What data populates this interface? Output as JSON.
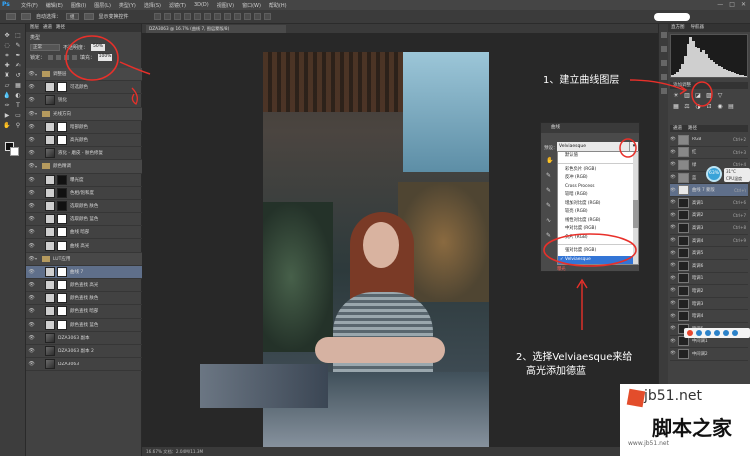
{
  "menubar": {
    "logo": "Ps",
    "items": [
      "文件(F)",
      "编辑(E)",
      "图像(I)",
      "图层(L)",
      "类型(Y)",
      "选择(S)",
      "滤镜(T)",
      "3D(D)",
      "视图(V)",
      "窗口(W)",
      "帮助(H)"
    ],
    "window_buttons": [
      "—",
      "□",
      "✕"
    ]
  },
  "options_bar": {
    "auto_select_label": "自动选择：",
    "auto_select_value": "组",
    "show_transform_label": "显示变换控件"
  },
  "layers_panel": {
    "tabs": [
      "图层",
      "通道",
      "路径"
    ],
    "type_label": "类型",
    "blend_mode": "正常",
    "opacity_label": "不透明度：",
    "opacity_value": "50%",
    "lock_label": "锁定：",
    "fill_label": "填充：",
    "fill_value": "100%",
    "layers": [
      {
        "name": "调整层",
        "type": "group"
      },
      {
        "name": "可选颜色",
        "type": "adj"
      },
      {
        "name": "锐化",
        "type": "photo"
      },
      {
        "name": "光线方向",
        "type": "group"
      },
      {
        "name": "暗部颜色",
        "type": "adj"
      },
      {
        "name": "高光颜色",
        "type": "adj"
      },
      {
        "name": "液化 - 磨皮 - 肤色修复",
        "type": "photo"
      },
      {
        "name": "颜色精调",
        "type": "group"
      },
      {
        "name": "曝光度",
        "type": "adj-black"
      },
      {
        "name": "色相/饱和度",
        "type": "adj-black"
      },
      {
        "name": "选取颜色 肤色",
        "type": "adj-black"
      },
      {
        "name": "选取颜色 蓝色",
        "type": "adj"
      },
      {
        "name": "曲线 暗部",
        "type": "adj"
      },
      {
        "name": "曲线 高光",
        "type": "adj"
      },
      {
        "name": "LUT应用",
        "type": "group"
      },
      {
        "name": "曲线 7",
        "type": "selected"
      },
      {
        "name": "颜色查找 高光",
        "type": "adj"
      },
      {
        "name": "颜色查找 肤色",
        "type": "adj"
      },
      {
        "name": "颜色查找 暗部",
        "type": "adj"
      },
      {
        "name": "颜色查找 蓝色",
        "type": "adj"
      },
      {
        "name": "DZA3063 副本",
        "type": "photo"
      },
      {
        "name": "DZA3063 副本 2",
        "type": "photo"
      },
      {
        "name": "DZA3063",
        "type": "photo"
      }
    ]
  },
  "document": {
    "tab_title": "DZA3063 @ 16.7% (曲线 7, 图层蒙版/8)",
    "status": "16.67%   文档：2.04M/11.3M"
  },
  "annotations": {
    "step1": "1、建立曲线图层",
    "step2_line1": "2、选择Velviaesque来给",
    "step2_line2": "高光添加德蓝"
  },
  "curves_panel": {
    "title": "曲线",
    "preset_label": "预设：",
    "current": "Velviaesque",
    "dropdown_btn": "▾",
    "tools": [
      "✋",
      "✎",
      "✎",
      "✎",
      "∿",
      "✎"
    ],
    "options": [
      "默认值",
      "彩色负片 (RGB)",
      "反冲 (RGB)",
      "Cross Process",
      "较暗 (RGB)",
      "增加对比度 (RGB)",
      "较亮 (RGB)",
      "线性对比度 (RGB)",
      "中对比度 (RGB)",
      "负片 (RGB)",
      "强对比度 (RGB)",
      "Velviaesque"
    ],
    "selected_option": "Velviaesque",
    "bottom_option": "曝光"
  },
  "histogram": {
    "tabs": [
      "直方图",
      "导航器"
    ],
    "bars": [
      2,
      3,
      5,
      8,
      14,
      22,
      35,
      42,
      38,
      32,
      30,
      26,
      28,
      24,
      20,
      18,
      16,
      14,
      12,
      10,
      8,
      7,
      6,
      5,
      4,
      3,
      2,
      2,
      1,
      1
    ]
  },
  "adjustments": {
    "title": "添加调整",
    "row1": [
      "☀",
      "▥",
      "◪",
      "▨",
      "▽"
    ],
    "row2": [
      "▦",
      "⚖",
      "◑",
      "⊡",
      "◉",
      "▤"
    ]
  },
  "channels": {
    "tabs": [
      "通道",
      "路径"
    ],
    "rows": [
      {
        "name": "RGB",
        "shortcut": "Ctrl+2",
        "thumb": "gray"
      },
      {
        "name": "红",
        "shortcut": "Ctrl+3",
        "thumb": "gray"
      },
      {
        "name": "绿",
        "shortcut": "Ctrl+4",
        "thumb": "gray"
      },
      {
        "name": "蓝",
        "shortcut": "Ctrl+5",
        "thumb": "gray"
      },
      {
        "name": "曲线 7 蒙版",
        "shortcut": "Ctrl+\\",
        "thumb": "light",
        "selected": true
      },
      {
        "name": "高调1",
        "shortcut": "Ctrl+6",
        "thumb": "dark"
      },
      {
        "name": "高调2",
        "shortcut": "Ctrl+7",
        "thumb": "dark"
      },
      {
        "name": "高调3",
        "shortcut": "Ctrl+8",
        "thumb": "dark"
      },
      {
        "name": "高调4",
        "shortcut": "Ctrl+9",
        "thumb": "dark"
      },
      {
        "name": "高调5",
        "shortcut": "",
        "thumb": "dark"
      },
      {
        "name": "高调6",
        "shortcut": "",
        "thumb": "dark"
      },
      {
        "name": "暗调1",
        "shortcut": "",
        "thumb": "dark"
      },
      {
        "name": "暗调2",
        "shortcut": "",
        "thumb": "dark"
      },
      {
        "name": "暗调3",
        "shortcut": "",
        "thumb": "dark"
      },
      {
        "name": "暗调4",
        "shortcut": "",
        "thumb": "dark"
      },
      {
        "name": "暗调5",
        "shortcut": "",
        "thumb": "dark"
      },
      {
        "name": "中间调1",
        "shortcut": "",
        "thumb": "dark"
      },
      {
        "name": "中间调2",
        "shortcut": "",
        "thumb": "dark"
      }
    ]
  },
  "cpu_widget": {
    "percent": "63%",
    "line1": "31°C",
    "line2": "CPU温度"
  },
  "watermark": {
    "url": "jb51.net",
    "name": "脚本之家",
    "site": "www.jb51.net"
  },
  "colors": {
    "accent_red": "#e8302a",
    "selection_blue": "#3375d6",
    "panel_bg": "#424242",
    "canvas_bg": "#282828"
  }
}
